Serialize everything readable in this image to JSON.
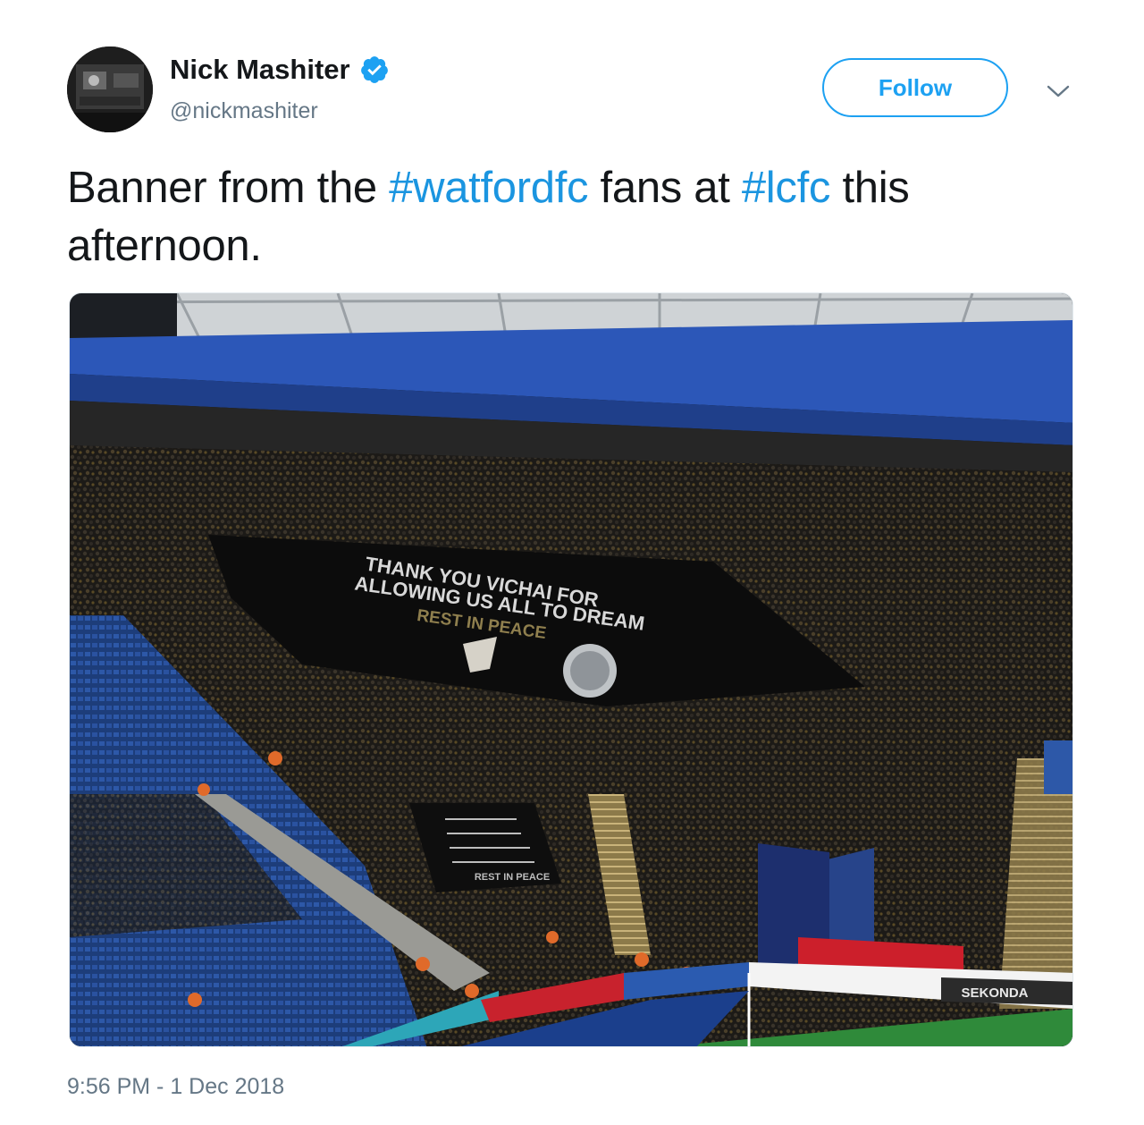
{
  "author": {
    "display_name": "Nick Mashiter",
    "handle": "@nickmashiter",
    "verified": true
  },
  "follow_label": "Follow",
  "tweet": {
    "part1": "Banner from the ",
    "hashtag1": "#watfordfc",
    "part2": " fans at ",
    "hashtag2": "#lcfc",
    "part3": " this afternoon."
  },
  "photo": {
    "banner_line1": "THANK YOU VICHAI FOR",
    "banner_line2": "ALLOWING US ALL TO DREAM",
    "banner_line3": "REST IN PEACE",
    "small_banner_last_line": "REST IN PEACE",
    "ad_board_1": "SEKONDA"
  },
  "timestamp": "9:56 PM - 1 Dec 2018",
  "colors": {
    "link": "#1b95e0",
    "follow_border": "#1da1f2",
    "verified": "#1da1f2",
    "secondary_text": "#657786",
    "primary_text": "#14171a"
  },
  "icons": {
    "verified": "verified-badge-icon",
    "chevron": "chevron-down-icon"
  }
}
